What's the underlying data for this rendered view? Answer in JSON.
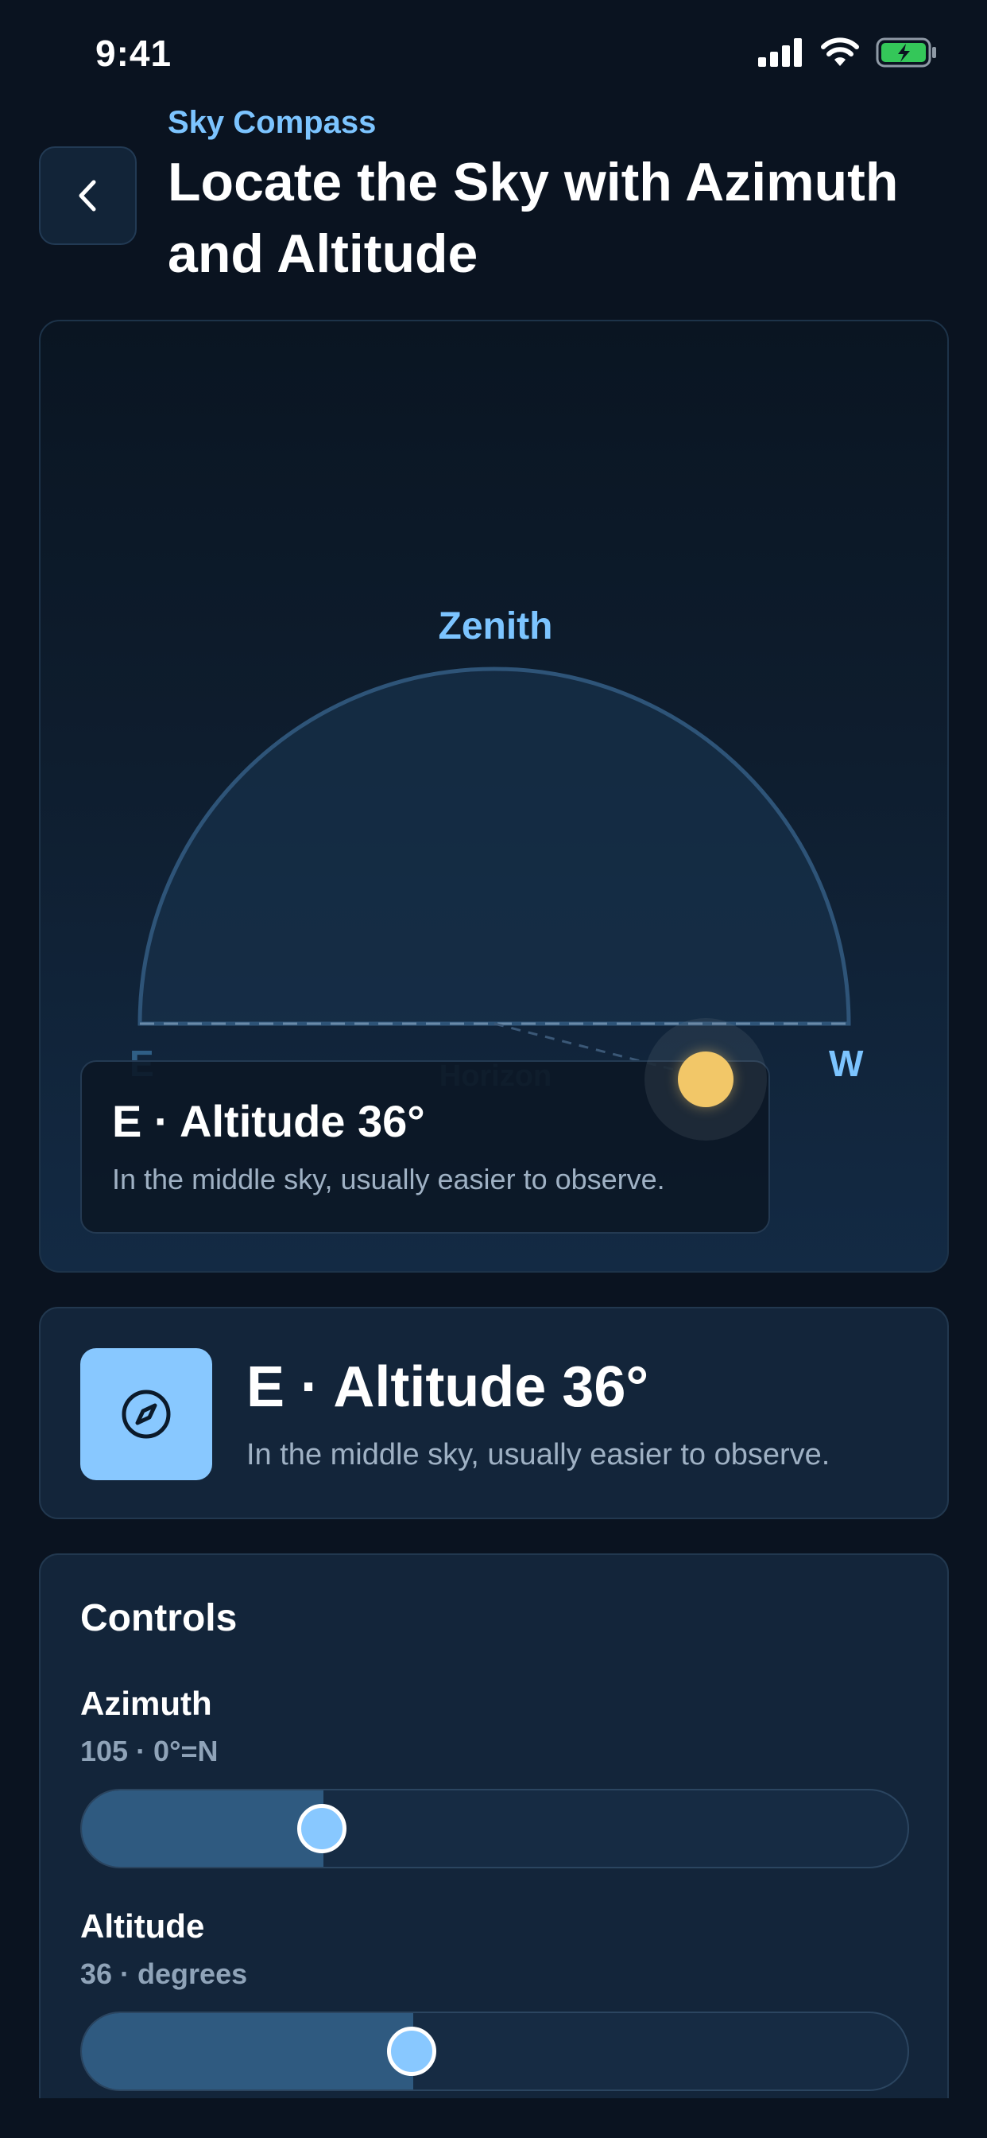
{
  "status_bar": {
    "time": "9:41"
  },
  "header": {
    "eyebrow": "Sky Compass",
    "title": "Locate the Sky with Azimuth and Altitude"
  },
  "sky": {
    "zenith_label": "Zenith",
    "horizon_label": "Horizon",
    "east_label": "E",
    "west_label": "W",
    "overlay_title": "E · Altitude 36°",
    "overlay_desc": "In the middle sky, usually easier to observe."
  },
  "info": {
    "icon": "compass-icon",
    "title": "E · Altitude 36°",
    "desc": "In the middle sky, usually easier to observe."
  },
  "controls": {
    "title": "Controls",
    "azimuth": {
      "label": "Azimuth",
      "sub": "105 · 0°=N",
      "value": 105,
      "max": 360
    },
    "altitude": {
      "label": "Altitude",
      "sub": "36 · degrees",
      "value": 36,
      "max": 90
    }
  },
  "colors": {
    "background": "#0a1320",
    "accent": "#7cc4ff",
    "card": "#13253a",
    "sun": "#f2c768"
  }
}
